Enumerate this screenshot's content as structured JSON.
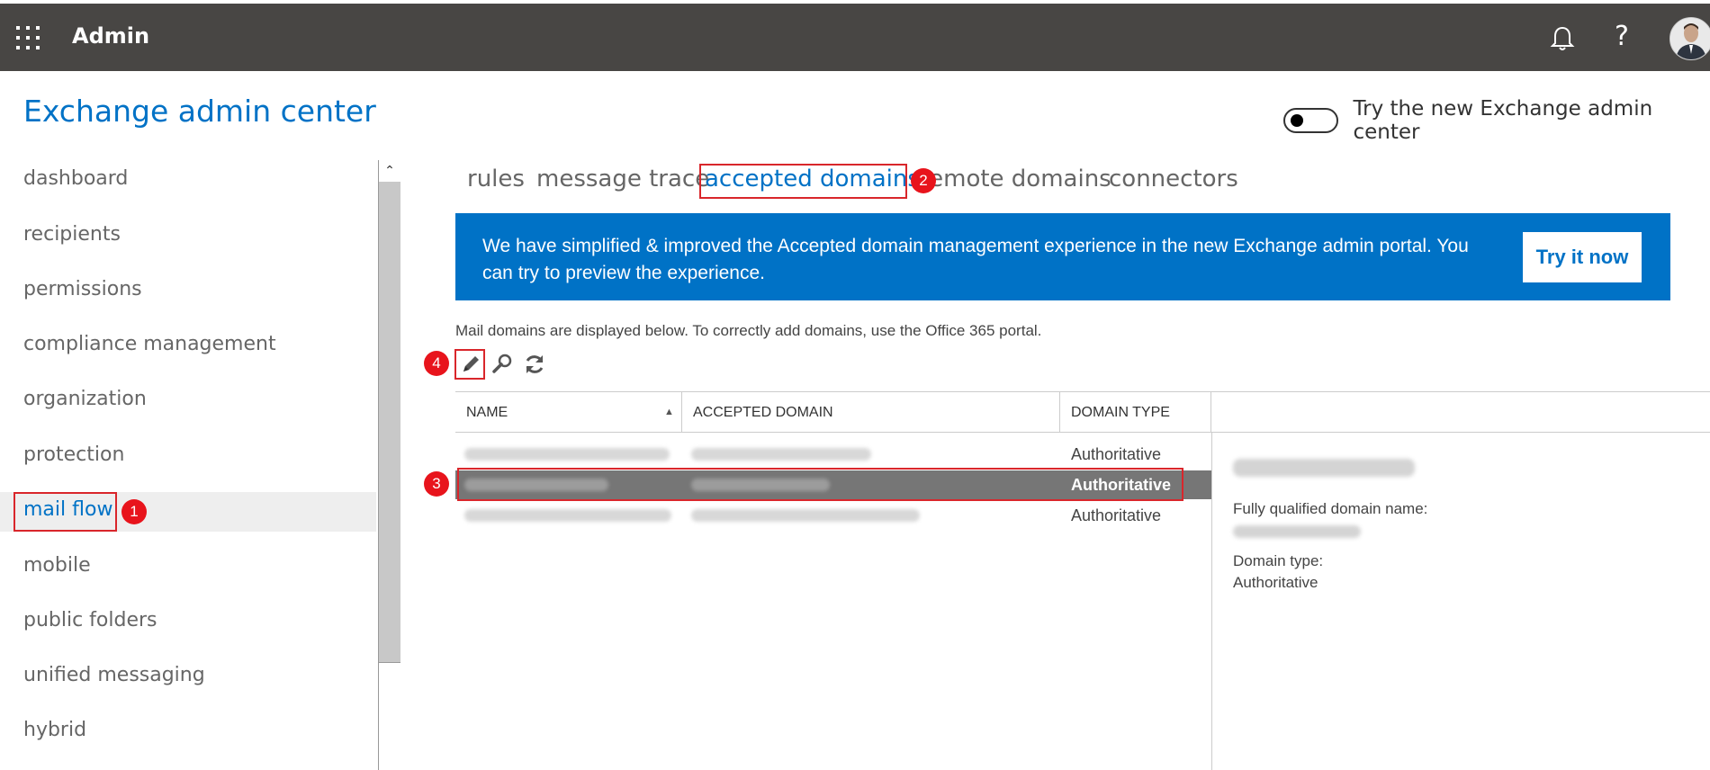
{
  "topbar": {
    "app_title": "Admin",
    "icons": [
      "app-launcher-icon",
      "bell-icon",
      "help-icon",
      "avatar"
    ],
    "help_glyph": "?",
    "background": "#484644"
  },
  "page": {
    "title": "Exchange admin center",
    "toggle_label": "Try the new Exchange admin center",
    "toggle_on": false
  },
  "sidebar": {
    "items": [
      {
        "label": "dashboard"
      },
      {
        "label": "recipients"
      },
      {
        "label": "permissions"
      },
      {
        "label": "compliance management"
      },
      {
        "label": "organization"
      },
      {
        "label": "protection"
      },
      {
        "label": "mail flow",
        "active": true
      },
      {
        "label": "mobile"
      },
      {
        "label": "public folders"
      },
      {
        "label": "unified messaging"
      },
      {
        "label": "hybrid"
      }
    ]
  },
  "tabs": [
    {
      "label": "rules"
    },
    {
      "label": "message trace"
    },
    {
      "label": "accepted domains",
      "active": true
    },
    {
      "label": "remote domains"
    },
    {
      "label": "connectors"
    }
  ],
  "banner": {
    "text": "We have simplified & improved the Accepted domain management experience in the new Exchange admin portal. You can try to preview the experience.",
    "button_label": "Try it now",
    "background": "#0072c6"
  },
  "info_text": "Mail domains are displayed below. To correctly add domains, use the Office 365 portal.",
  "toolbar": {
    "icons": [
      "edit-icon",
      "search-icon",
      "refresh-icon"
    ]
  },
  "table": {
    "columns": [
      "NAME",
      "ACCEPTED DOMAIN",
      "DOMAIN TYPE"
    ],
    "sort_column": "NAME",
    "rows": [
      {
        "domain_type": "Authoritative",
        "selected": false
      },
      {
        "domain_type": "Authoritative",
        "selected": true
      },
      {
        "domain_type": "Authoritative",
        "selected": false
      }
    ]
  },
  "details": {
    "fqdn_label": "Fully qualified domain name:",
    "type_label": "Domain type:",
    "type_value": "Authoritative"
  },
  "annotations": [
    "1",
    "2",
    "3",
    "4"
  ],
  "colors": {
    "accent": "#0072c6",
    "annotation": "#e8141c",
    "selected_row": "#767676"
  }
}
